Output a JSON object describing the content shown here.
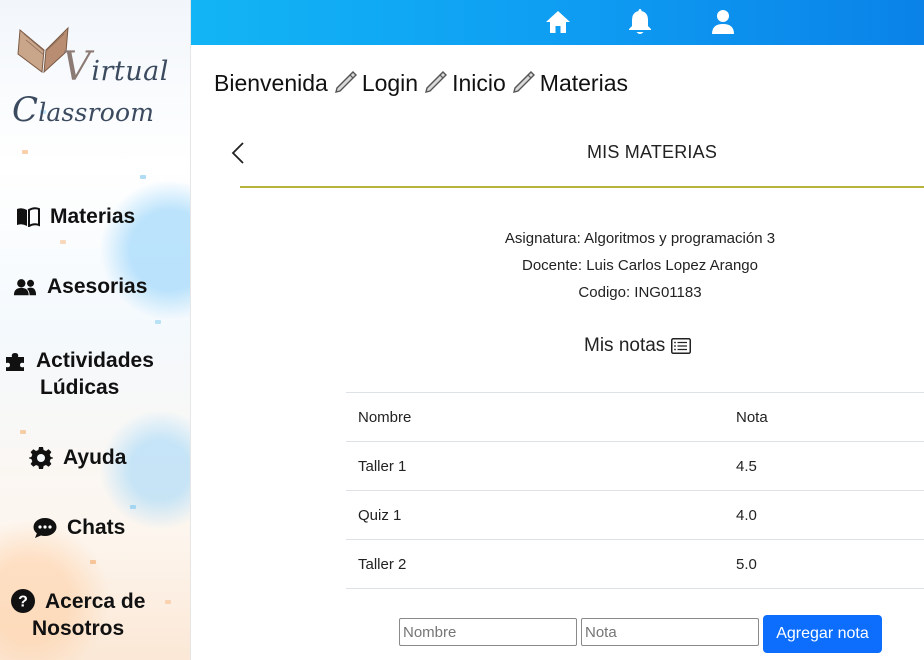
{
  "brand": {
    "line1": "irtual",
    "line1_initial": "V",
    "line2": "lassroom",
    "line2_initial": "C"
  },
  "sidebar": {
    "items": [
      {
        "label": "Materias",
        "icon": "book-open-icon"
      },
      {
        "label": "Asesorias",
        "icon": "users-icon"
      },
      {
        "label_line1": "Actividades",
        "label_line2": "Lúdicas",
        "icon": "puzzle-icon"
      },
      {
        "label": "Ayuda",
        "icon": "gear-icon"
      },
      {
        "label": "Chats",
        "icon": "chat-icon"
      },
      {
        "label_line1": "Acerca de",
        "label_line2": "Nosotros",
        "icon": "question-icon"
      }
    ]
  },
  "topbar": {
    "icons": [
      "home-icon",
      "bell-icon",
      "user-icon"
    ],
    "color": "#0e9bf2"
  },
  "breadcrumb": {
    "items": [
      "Bienvenida",
      "Login",
      "Inicio",
      "Materias"
    ],
    "separator_icon": "pencil-icon"
  },
  "header": {
    "title": "MIS MATERIAS"
  },
  "course": {
    "subject": "Asignatura: Algoritmos y programación 3",
    "teacher": "Docente: Luis Carlos Lopez Arango",
    "code": "Codigo: ING01183"
  },
  "grades": {
    "title": "Mis notas",
    "columns": [
      "Nombre",
      "Nota"
    ],
    "rows": [
      {
        "name": "Taller 1",
        "grade": "4.5"
      },
      {
        "name": "Quiz 1",
        "grade": "4.0"
      },
      {
        "name": "Taller 2",
        "grade": "5.0"
      }
    ]
  },
  "form": {
    "name_placeholder": "Nombre",
    "grade_placeholder": "Nota",
    "submit_label": "Agregar nota"
  },
  "colors": {
    "accent": "#0d6efd",
    "divider": "#b7b43a"
  }
}
